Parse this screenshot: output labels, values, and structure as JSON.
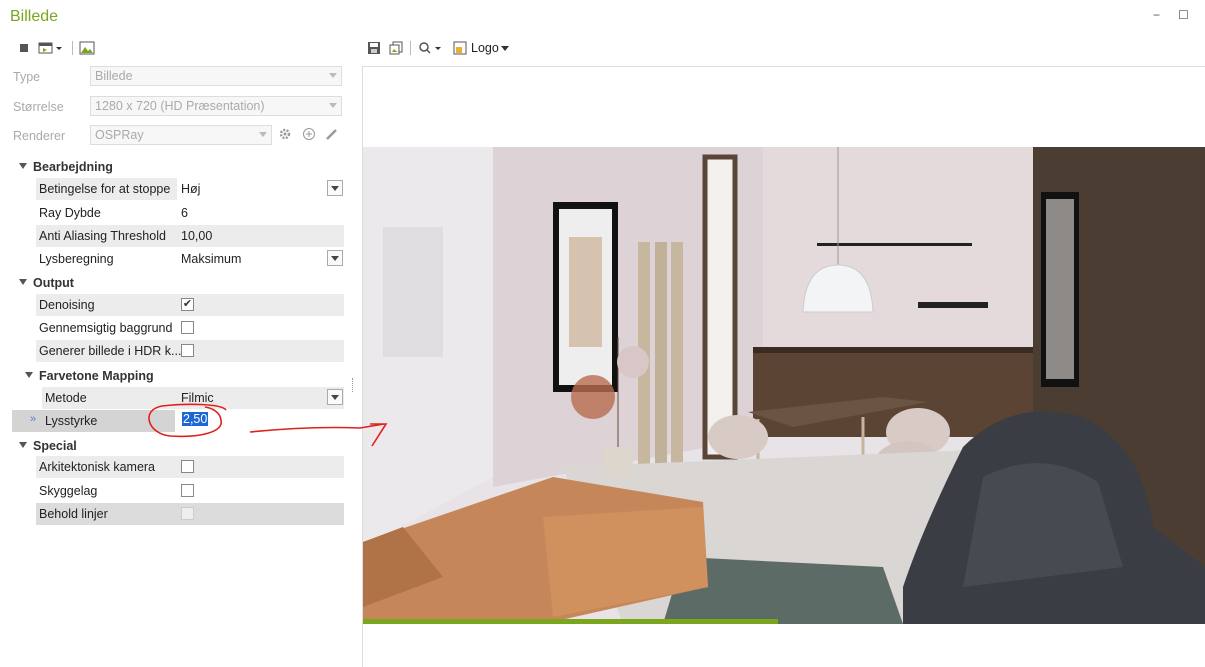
{
  "window": {
    "title": "Billede",
    "minimize": "−",
    "maximize": "☐"
  },
  "left_toolbar": {
    "icons": [
      "stop-icon",
      "render-menu-icon",
      "image-view-icon"
    ]
  },
  "right_toolbar": {
    "logo_label": "Logo",
    "icons": [
      "save-icon",
      "copy-icon",
      "zoom-icon",
      "logo-icon"
    ]
  },
  "fields": [
    {
      "label": "Type",
      "value": "Billede"
    },
    {
      "label": "Størrelse",
      "value": "1280 x 720 (HD Præsentation)"
    },
    {
      "label": "Renderer",
      "value": "OSPRay"
    }
  ],
  "sections": {
    "bearbejdning": {
      "title": "Bearbejdning",
      "props": [
        {
          "label": "Betingelse for at stoppe",
          "value": "Høj"
        },
        {
          "label": "Ray Dybde",
          "value": "6"
        },
        {
          "label": "Anti Aliasing Threshold",
          "value": "10,00"
        },
        {
          "label": "Lysberegning",
          "value": "Maksimum"
        }
      ]
    },
    "output": {
      "title": "Output",
      "props": [
        {
          "label": "Denoising",
          "checked": true
        },
        {
          "label": "Gennemsigtig baggrund",
          "checked": false
        },
        {
          "label": "Generer billede i HDR k...",
          "checked": false
        }
      ]
    },
    "farvetone": {
      "title": "Farvetone Mapping",
      "props": [
        {
          "label": "Metode",
          "value": "Filmic"
        },
        {
          "label": "Lysstyrke",
          "value": "2,50"
        }
      ]
    },
    "special": {
      "title": "Special",
      "props": [
        {
          "label": "Arkitektonisk kamera",
          "checked": false
        },
        {
          "label": "Skyggelag",
          "checked": false
        },
        {
          "label": "Behold linjer",
          "checked": false
        }
      ]
    }
  },
  "colors": {
    "accent": "#7aa61e",
    "annotation": "#e0201b",
    "selection": "#1e66d6"
  }
}
